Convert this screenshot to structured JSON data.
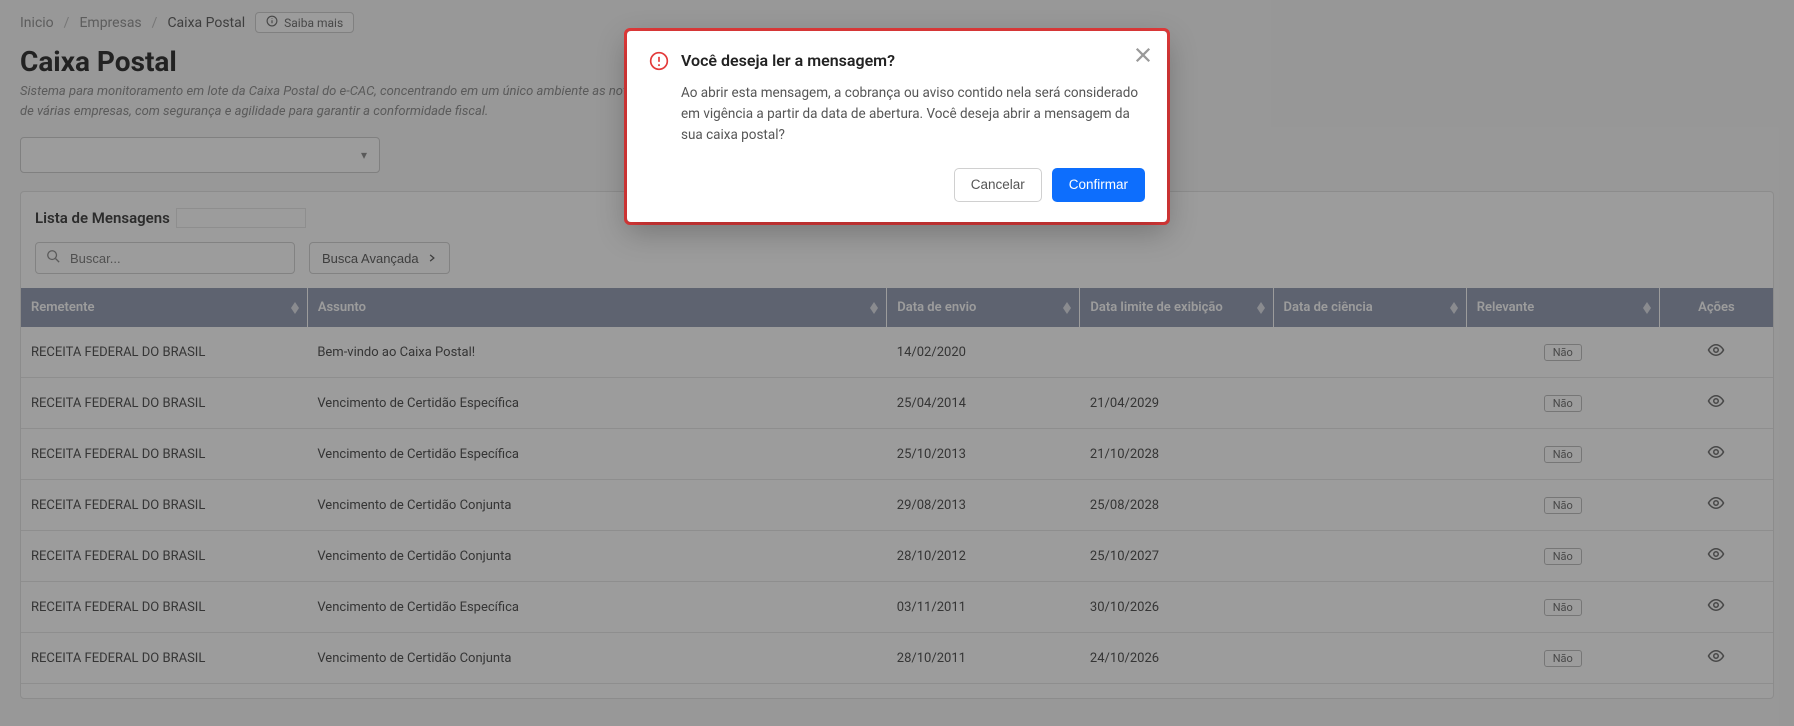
{
  "breadcrumbs": {
    "items": [
      "Inicio",
      "Empresas",
      "Caixa Postal"
    ],
    "saibaMais": "Saiba mais"
  },
  "header": {
    "title": "Caixa Postal",
    "subtitle": "Sistema para monitoramento em lote da Caixa Postal do e-CAC, concentrando em um único ambiente as notificações e comunicados da Receita Federal de várias empresas, com segurança e agilidade para garantir a conformidade fiscal."
  },
  "card": {
    "title": "Lista de Mensagens"
  },
  "toolbar": {
    "searchPlaceholder": "Buscar...",
    "advSearch": "Busca Avançada"
  },
  "table": {
    "columns": {
      "remetente": "Remetente",
      "assunto": "Assunto",
      "envio": "Data de envio",
      "limite": "Data limite de exibição",
      "ciencia": "Data de ciência",
      "relevante": "Relevante",
      "acoes": "Ações"
    },
    "naoLabel": "Não",
    "rows": [
      {
        "remetente": "RECEITA FEDERAL DO BRASIL",
        "assunto": "Bem-vindo ao Caixa Postal!",
        "envio": "14/02/2020",
        "limite": "",
        "ciencia": "",
        "relevante": "Não"
      },
      {
        "remetente": "RECEITA FEDERAL DO BRASIL",
        "assunto": "Vencimento de Certidão Específica",
        "envio": "25/04/2014",
        "limite": "21/04/2029",
        "ciencia": "",
        "relevante": "Não"
      },
      {
        "remetente": "RECEITA FEDERAL DO BRASIL",
        "assunto": "Vencimento de Certidão Específica",
        "envio": "25/10/2013",
        "limite": "21/10/2028",
        "ciencia": "",
        "relevante": "Não"
      },
      {
        "remetente": "RECEITA FEDERAL DO BRASIL",
        "assunto": "Vencimento de Certidão Conjunta",
        "envio": "29/08/2013",
        "limite": "25/08/2028",
        "ciencia": "",
        "relevante": "Não"
      },
      {
        "remetente": "RECEITA FEDERAL DO BRASIL",
        "assunto": "Vencimento de Certidão Conjunta",
        "envio": "28/10/2012",
        "limite": "25/10/2027",
        "ciencia": "",
        "relevante": "Não"
      },
      {
        "remetente": "RECEITA FEDERAL DO BRASIL",
        "assunto": "Vencimento de Certidão Específica",
        "envio": "03/11/2011",
        "limite": "30/10/2026",
        "ciencia": "",
        "relevante": "Não"
      },
      {
        "remetente": "RECEITA FEDERAL DO BRASIL",
        "assunto": "Vencimento de Certidão Conjunta",
        "envio": "28/10/2011",
        "limite": "24/10/2026",
        "ciencia": "",
        "relevante": "Não"
      }
    ]
  },
  "modal": {
    "title": "Você deseja ler a mensagem?",
    "body": "Ao abrir esta mensagem, a cobrança ou aviso contido nela será considerado em vigência a partir da data de abertura. Você deseja abrir a mensagem da sua caixa postal?",
    "cancel": "Cancelar",
    "confirm": "Confirmar"
  }
}
